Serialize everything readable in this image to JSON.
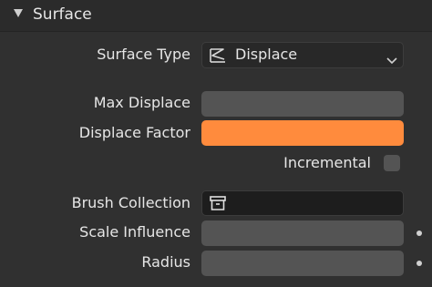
{
  "panel": {
    "title": "Surface"
  },
  "surface_type": {
    "label": "Surface Type",
    "value": "Displace",
    "icon": "displace-icon"
  },
  "max_displace": {
    "label": "Max Displace",
    "value": ""
  },
  "displace_factor": {
    "label": "Displace Factor",
    "value": "",
    "color": "#ff8b3d"
  },
  "incremental": {
    "label": "Incremental",
    "checked": false
  },
  "brush_collection": {
    "label": "Brush Collection",
    "icon": "collection-box-icon"
  },
  "scale_influence": {
    "label": "Scale Influence",
    "value": ""
  },
  "radius": {
    "label": "Radius",
    "value": ""
  }
}
